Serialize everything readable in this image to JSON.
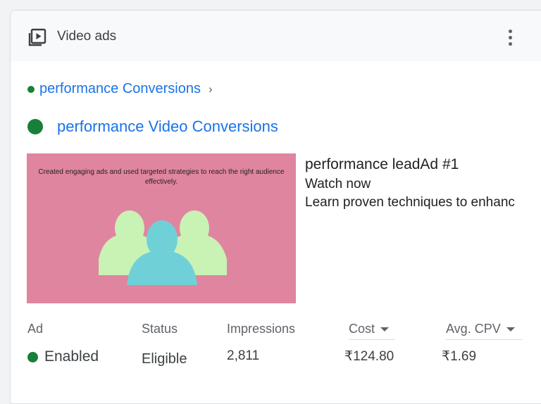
{
  "header": {
    "title": "Video ads",
    "icon": "video-play-icon",
    "menu_icon": "more-vert-icon"
  },
  "breadcrumb": {
    "label": "performance Conversions",
    "chevron": "›"
  },
  "campaign": {
    "name": "performance Video Conversions",
    "status_color": "#188038"
  },
  "ad": {
    "thumbnail_caption": "Created engaging ads and used targeted strategies to reach the right audience effectively.",
    "headline": "performance leadAd #1",
    "line1": "Watch now",
    "line2": "Learn proven techniques to enhanc"
  },
  "table": {
    "columns": {
      "ad": "Ad",
      "status": "Status",
      "impressions": "Impressions",
      "cost": "Cost",
      "avg_cpv": "Avg. CPV"
    },
    "row": {
      "ad_status": "Enabled",
      "status": "Eligible",
      "impressions": "2,811",
      "cost": "₹124.80",
      "avg_cpv": "₹1.69"
    }
  },
  "colors": {
    "accent": "#1a73e8",
    "enabled": "#188038",
    "thumbnail_bg": "#e0859f"
  }
}
